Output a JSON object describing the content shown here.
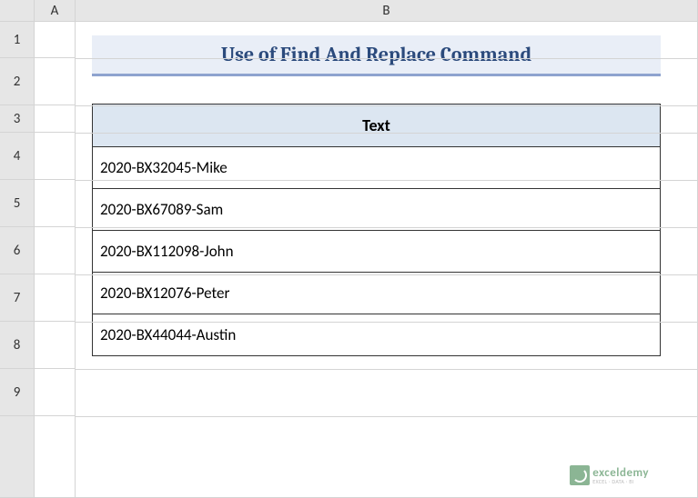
{
  "columns": {
    "A": "A",
    "B": "B"
  },
  "rows": {
    "r1": "1",
    "r2": "2",
    "r3": "3",
    "r4": "4",
    "r5": "5",
    "r6": "6",
    "r7": "7",
    "r8": "8",
    "r9": "9"
  },
  "title": "Use of Find And Replace Command",
  "table": {
    "header": "Text",
    "rows": [
      "2020-BX32045-Mike",
      "2020-BX67089-Sam",
      "2020-BX112098-John",
      "2020-BX12076-Peter",
      "2020-BX44044-Austin"
    ]
  },
  "watermark": {
    "brand": "exceldemy",
    "tag": "EXCEL · DATA · BI"
  }
}
